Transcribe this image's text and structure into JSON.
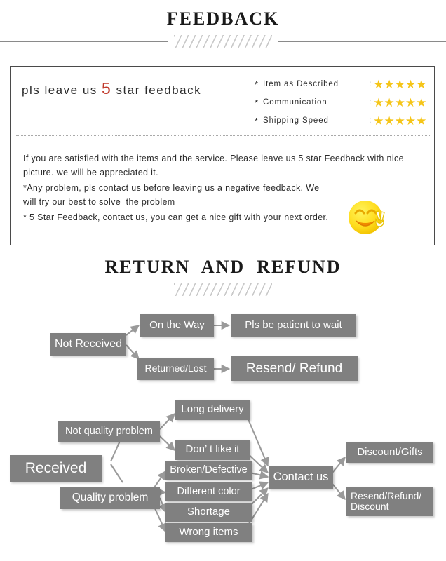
{
  "sections": {
    "feedback_title": "FEEDBACK",
    "return_title": "RETURN  AND  REFUND"
  },
  "feedback": {
    "headline_before": "pls leave us ",
    "headline_number": "5",
    "headline_after": " star feedback",
    "ratings": [
      {
        "marker": "*",
        "label": "Item as Described",
        "colon": ":",
        "stars": "★★★★★",
        "star_count": 5
      },
      {
        "marker": "*",
        "label": "Communication",
        "colon": ":",
        "stars": "★★★★★",
        "star_count": 5
      },
      {
        "marker": "*",
        "label": "Shipping Speed",
        "colon": ":",
        "stars": "★★★★★",
        "star_count": 5
      }
    ],
    "body": [
      "If you are satisfied with the items and the service. Please leave us 5 star Feedback with nice",
      "picture. we will be appreciated it.",
      "*Any problem, pls contact us before leaving us a negative feedback. We",
      "will try our best to solve  the problem",
      "* 5 Star Feedback, contact us, you can get a nice gift with your next order."
    ],
    "emoji": "smiling-face-with-victory-hand",
    "star_color": "#f5c518",
    "number_color": "#c0392b"
  },
  "flowchart": {
    "node_color": "#808080",
    "arrow_color": "#9a9a9a",
    "nodes": [
      {
        "id": "not-received",
        "label": "Not Received"
      },
      {
        "id": "on-the-way",
        "label": "On the Way"
      },
      {
        "id": "pls-be-patient",
        "label": "Pls be patient to wait"
      },
      {
        "id": "returned-lost",
        "label": "Returned/Lost"
      },
      {
        "id": "resend-refund",
        "label": "Resend/ Refund"
      },
      {
        "id": "received",
        "label": "Received"
      },
      {
        "id": "not-quality",
        "label": "Not quality problem"
      },
      {
        "id": "quality",
        "label": "Quality problem"
      },
      {
        "id": "long-delivery",
        "label": "Long delivery"
      },
      {
        "id": "dont-like-it",
        "label": "Don’ t like it"
      },
      {
        "id": "broken-defective",
        "label": "Broken/Defective"
      },
      {
        "id": "different-color",
        "label": "Different color"
      },
      {
        "id": "shortage",
        "label": "Shortage"
      },
      {
        "id": "wrong-items",
        "label": "Wrong items"
      },
      {
        "id": "contact-us",
        "label": "Contact us"
      },
      {
        "id": "discount-gifts",
        "label": "Discount/Gifts"
      },
      {
        "id": "resend-refund-discount",
        "label": "Resend/Refund/\nDiscount"
      }
    ]
  }
}
